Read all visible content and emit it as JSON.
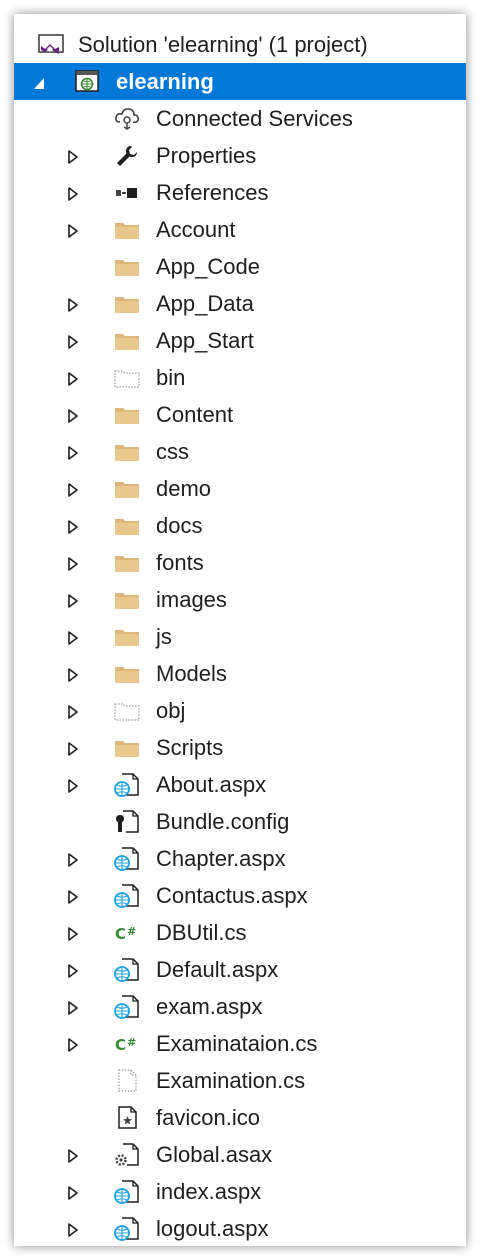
{
  "solution": {
    "label": "Solution 'elearning' (1 project)"
  },
  "project": {
    "label": "elearning"
  },
  "items": [
    {
      "label": "Connected Services",
      "icon": "connected-services-icon",
      "expandable": false
    },
    {
      "label": "Properties",
      "icon": "wrench-icon",
      "expandable": true
    },
    {
      "label": "References",
      "icon": "references-icon",
      "expandable": true
    },
    {
      "label": "Account",
      "icon": "folder-icon",
      "expandable": true
    },
    {
      "label": "App_Code",
      "icon": "folder-icon",
      "expandable": false
    },
    {
      "label": "App_Data",
      "icon": "folder-icon",
      "expandable": true
    },
    {
      "label": "App_Start",
      "icon": "folder-icon",
      "expandable": true
    },
    {
      "label": "bin",
      "icon": "dotted-folder-icon",
      "expandable": true
    },
    {
      "label": "Content",
      "icon": "folder-icon",
      "expandable": true
    },
    {
      "label": "css",
      "icon": "folder-icon",
      "expandable": true
    },
    {
      "label": "demo",
      "icon": "folder-icon",
      "expandable": true
    },
    {
      "label": "docs",
      "icon": "folder-icon",
      "expandable": true
    },
    {
      "label": "fonts",
      "icon": "folder-icon",
      "expandable": true
    },
    {
      "label": "images",
      "icon": "folder-icon",
      "expandable": true
    },
    {
      "label": "js",
      "icon": "folder-icon",
      "expandable": true
    },
    {
      "label": "Models",
      "icon": "folder-icon",
      "expandable": true
    },
    {
      "label": "obj",
      "icon": "dotted-folder-icon",
      "expandable": true
    },
    {
      "label": "Scripts",
      "icon": "folder-icon",
      "expandable": true
    },
    {
      "label": "About.aspx",
      "icon": "web-file-icon",
      "expandable": true
    },
    {
      "label": "Bundle.config",
      "icon": "config-file-icon",
      "expandable": false
    },
    {
      "label": "Chapter.aspx",
      "icon": "web-file-icon",
      "expandable": true
    },
    {
      "label": "Contactus.aspx",
      "icon": "web-file-icon",
      "expandable": true
    },
    {
      "label": "DBUtil.cs",
      "icon": "csharp-icon",
      "expandable": true
    },
    {
      "label": "Default.aspx",
      "icon": "web-file-icon",
      "expandable": true
    },
    {
      "label": "exam.aspx",
      "icon": "web-file-icon",
      "expandable": true
    },
    {
      "label": "Examinataion.cs",
      "icon": "csharp-icon",
      "expandable": true
    },
    {
      "label": "Examination.cs",
      "icon": "excluded-file-icon",
      "expandable": false
    },
    {
      "label": "favicon.ico",
      "icon": "image-file-icon",
      "expandable": false
    },
    {
      "label": "Global.asax",
      "icon": "global-asax-icon",
      "expandable": true
    },
    {
      "label": "index.aspx",
      "icon": "web-file-icon",
      "expandable": true
    },
    {
      "label": "logout.aspx",
      "icon": "web-file-icon",
      "expandable": true
    }
  ],
  "colors": {
    "selection": "#0078d7",
    "folder": "#dcb67a",
    "csharp": "#388a34",
    "vs_purple": "#68217a",
    "globe": "#1ba1e2"
  }
}
